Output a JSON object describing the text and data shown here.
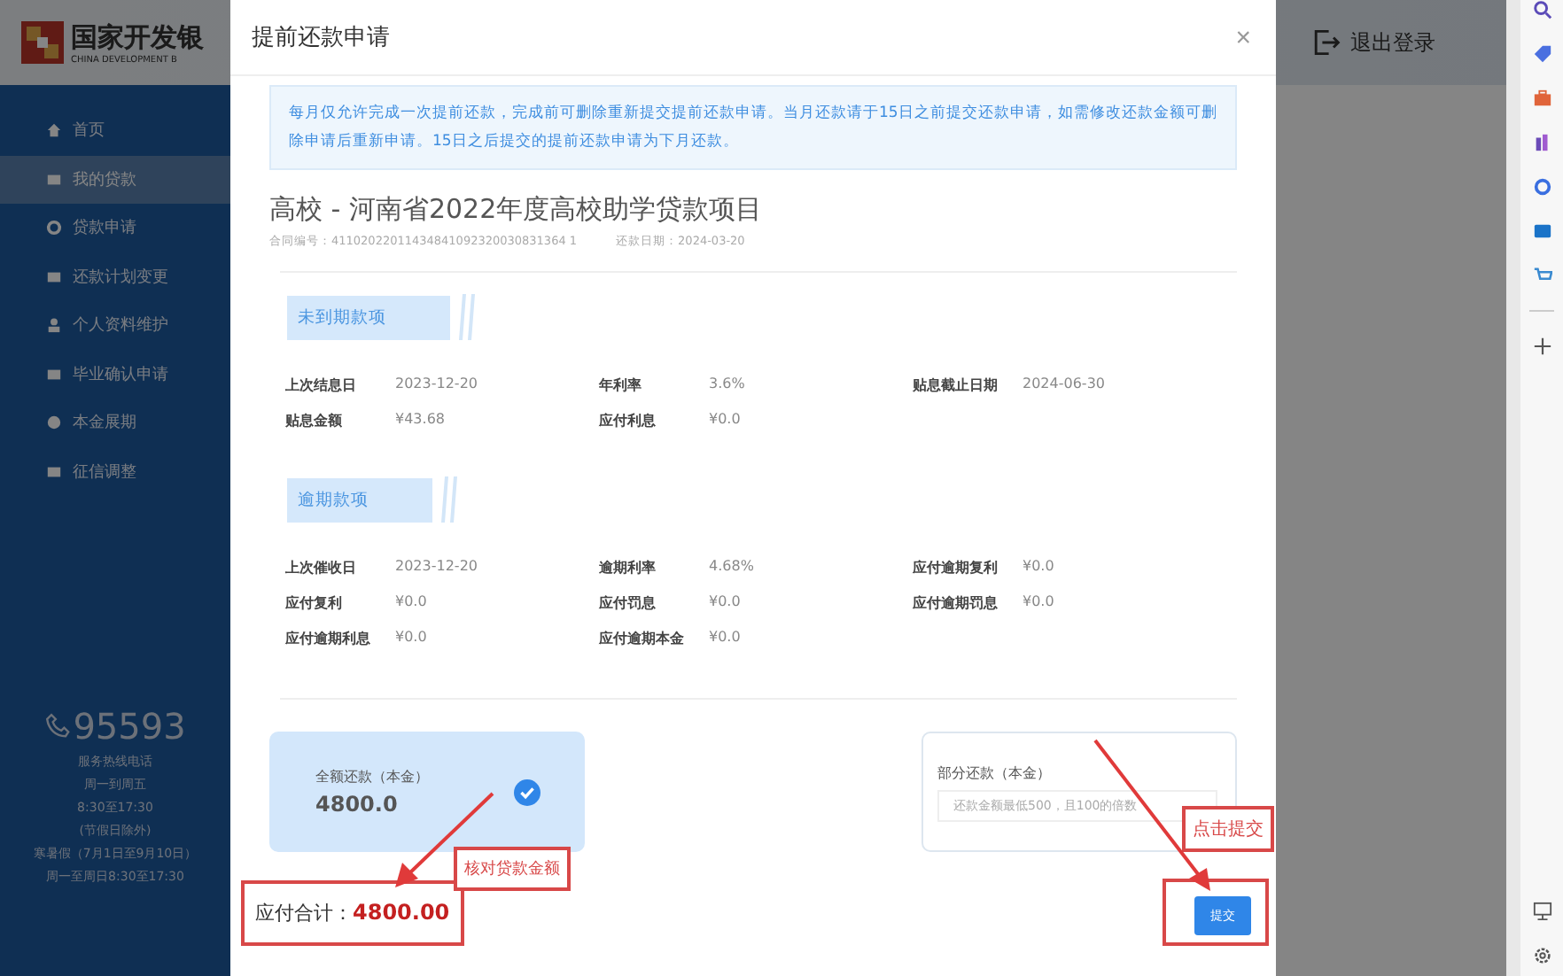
{
  "brand": {
    "name": "国家开发银",
    "subtitle": "CHINA DEVELOPMENT B"
  },
  "header": {
    "logout": "退出登录"
  },
  "sidebar": {
    "items": [
      {
        "label": "首页",
        "selected": false
      },
      {
        "label": "我的贷款",
        "selected": true
      },
      {
        "label": "贷款申请",
        "selected": false
      },
      {
        "label": "还款计划变更",
        "selected": false
      },
      {
        "label": "个人资料维护",
        "selected": false
      },
      {
        "label": "毕业确认申请",
        "selected": false
      },
      {
        "label": "本金展期",
        "selected": false
      },
      {
        "label": "征信调整",
        "selected": false
      }
    ],
    "hotline": {
      "number": "95593",
      "lines": [
        "服务热线电话",
        "周一到周五",
        "8:30至17:30",
        "(节假日除外)",
        "寒暑假（7月1日至9月10日）",
        "周一至周日8:30至17:30"
      ]
    }
  },
  "dialog": {
    "title": "提前还款申请",
    "close": "×",
    "notice": "每月仅允许完成一次提前还款，完成前可删除重新提交提前还款申请。当月还款请于15日之前提交还款申请，如需修改还款金额可删除申请后重新申请。15日之后提交的提前还款申请为下月还款。",
    "loan_title": "高校 - 河南省2022年度高校助学贷款项目",
    "contract": "合同编号：41102022011434841092320030831364 1",
    "repay_date": "还款日期：2024-03-20",
    "sections": [
      {
        "title": "未到期款项",
        "fields": [
          {
            "label": "上次结息日",
            "value": "2023-12-20"
          },
          {
            "label": "年利率",
            "value": "3.6%"
          },
          {
            "label": "贴息截止日期",
            "value": "2024-06-30"
          },
          {
            "label": "贴息金额",
            "value": "¥43.68"
          },
          {
            "label": "应付利息",
            "value": "¥0.0"
          }
        ]
      },
      {
        "title": "逾期款项",
        "fields": [
          {
            "label": "上次催收日",
            "value": "2023-12-20"
          },
          {
            "label": "逾期利率",
            "value": "4.68%"
          },
          {
            "label": "应付逾期复利",
            "value": "¥0.0"
          },
          {
            "label": "应付复利",
            "value": "¥0.0"
          },
          {
            "label": "应付罚息",
            "value": "¥0.0"
          },
          {
            "label": "应付逾期罚息",
            "value": "¥0.0"
          },
          {
            "label": "应付逾期利息",
            "value": "¥0.0"
          },
          {
            "label": "应付逾期本金",
            "value": "¥0.0"
          }
        ]
      }
    ],
    "payment_options": [
      {
        "kind": "full",
        "label": "全额还款（本金）",
        "amount": "4800.0",
        "selected": true
      },
      {
        "kind": "partial",
        "label": "部分还款（本金）",
        "placeholder": "还款金额最低500，且100的倍数",
        "selected": false
      }
    ],
    "total_label": "应付合计：",
    "total_value": "4800.00",
    "submit": "提交"
  },
  "annotations": [
    {
      "text": "核对贷款金额"
    },
    {
      "text": "点击提交"
    }
  ]
}
